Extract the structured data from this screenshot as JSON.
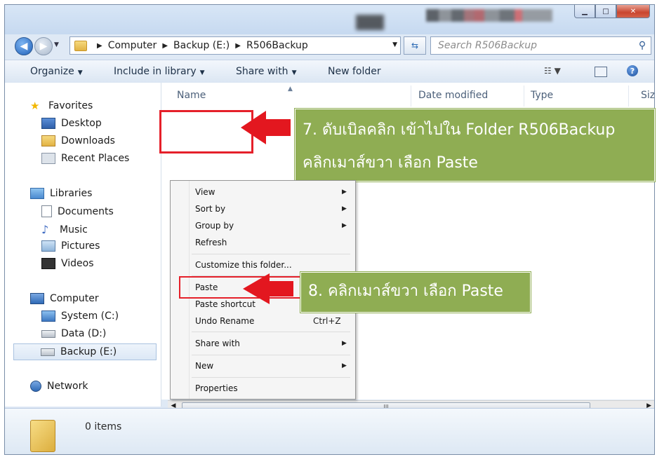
{
  "window": {
    "breadcrumb": [
      "Computer",
      "Backup (E:)",
      "R506Backup"
    ],
    "search_placeholder": "Search R506Backup"
  },
  "toolbar": {
    "organize": "Organize",
    "include_in_library": "Include in library",
    "share_with": "Share with",
    "new_folder": "New folder"
  },
  "nav": {
    "favorites": "Favorites",
    "desktop": "Desktop",
    "downloads": "Downloads",
    "recent_places": "Recent Places",
    "libraries": "Libraries",
    "documents": "Documents",
    "music": "Music",
    "pictures": "Pictures",
    "videos": "Videos",
    "computer": "Computer",
    "system_c": "System (C:)",
    "data_d": "Data (D:)",
    "backup_e": "Backup (E:)",
    "network": "Network"
  },
  "columns": {
    "name": "Name",
    "date_modified": "Date modified",
    "type": "Type",
    "size": "Size"
  },
  "context_menu": {
    "view": "View",
    "sort_by": "Sort by",
    "group_by": "Group by",
    "refresh": "Refresh",
    "customize": "Customize this folder...",
    "paste": "Paste",
    "paste_shortcut": "Paste shortcut",
    "undo_rename": "Undo Rename",
    "undo_shortcut": "Ctrl+Z",
    "share_with": "Share with",
    "new": "New",
    "properties": "Properties"
  },
  "callouts": {
    "step7_line1": "7. ดับเบิลคลิก เข้าไปใน Folder R506Backup",
    "step7_line2": "คลิกเมาส์ขวา เลือก Paste",
    "step8": "8. คลิกเมาส์ขวา เลือก Paste"
  },
  "scrollbar": {
    "thumb_grip": "III"
  },
  "details": {
    "item_count": "0 items"
  },
  "colors": {
    "callout_green": "#8fad53",
    "annotation_red": "#e3171f"
  }
}
